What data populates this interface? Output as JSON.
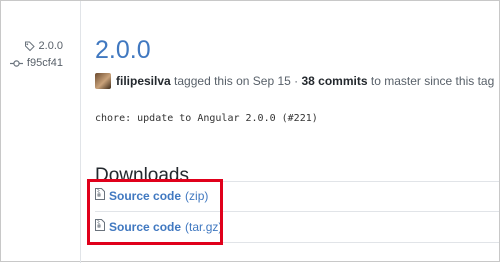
{
  "sidebar": {
    "tag_label": "2.0.0",
    "commit_label": "f95cf41"
  },
  "release": {
    "title": "2.0.0",
    "author": "filipesilva",
    "tagged_text": "tagged this on Sep 15 ·",
    "commits_count": "38 commits",
    "since_text": "to master since this tag",
    "commit_message": "chore: update to Angular 2.0.0 (#221)"
  },
  "downloads": {
    "heading": "Downloads",
    "items": [
      {
        "name": "Source code",
        "ext": "(zip)",
        "icon": "file-zip-icon"
      },
      {
        "name": "Source code",
        "ext": "(tar.gz)",
        "icon": "file-zip-icon"
      }
    ]
  },
  "colors": {
    "link": "#4078c0",
    "highlight": "#e0001b"
  }
}
